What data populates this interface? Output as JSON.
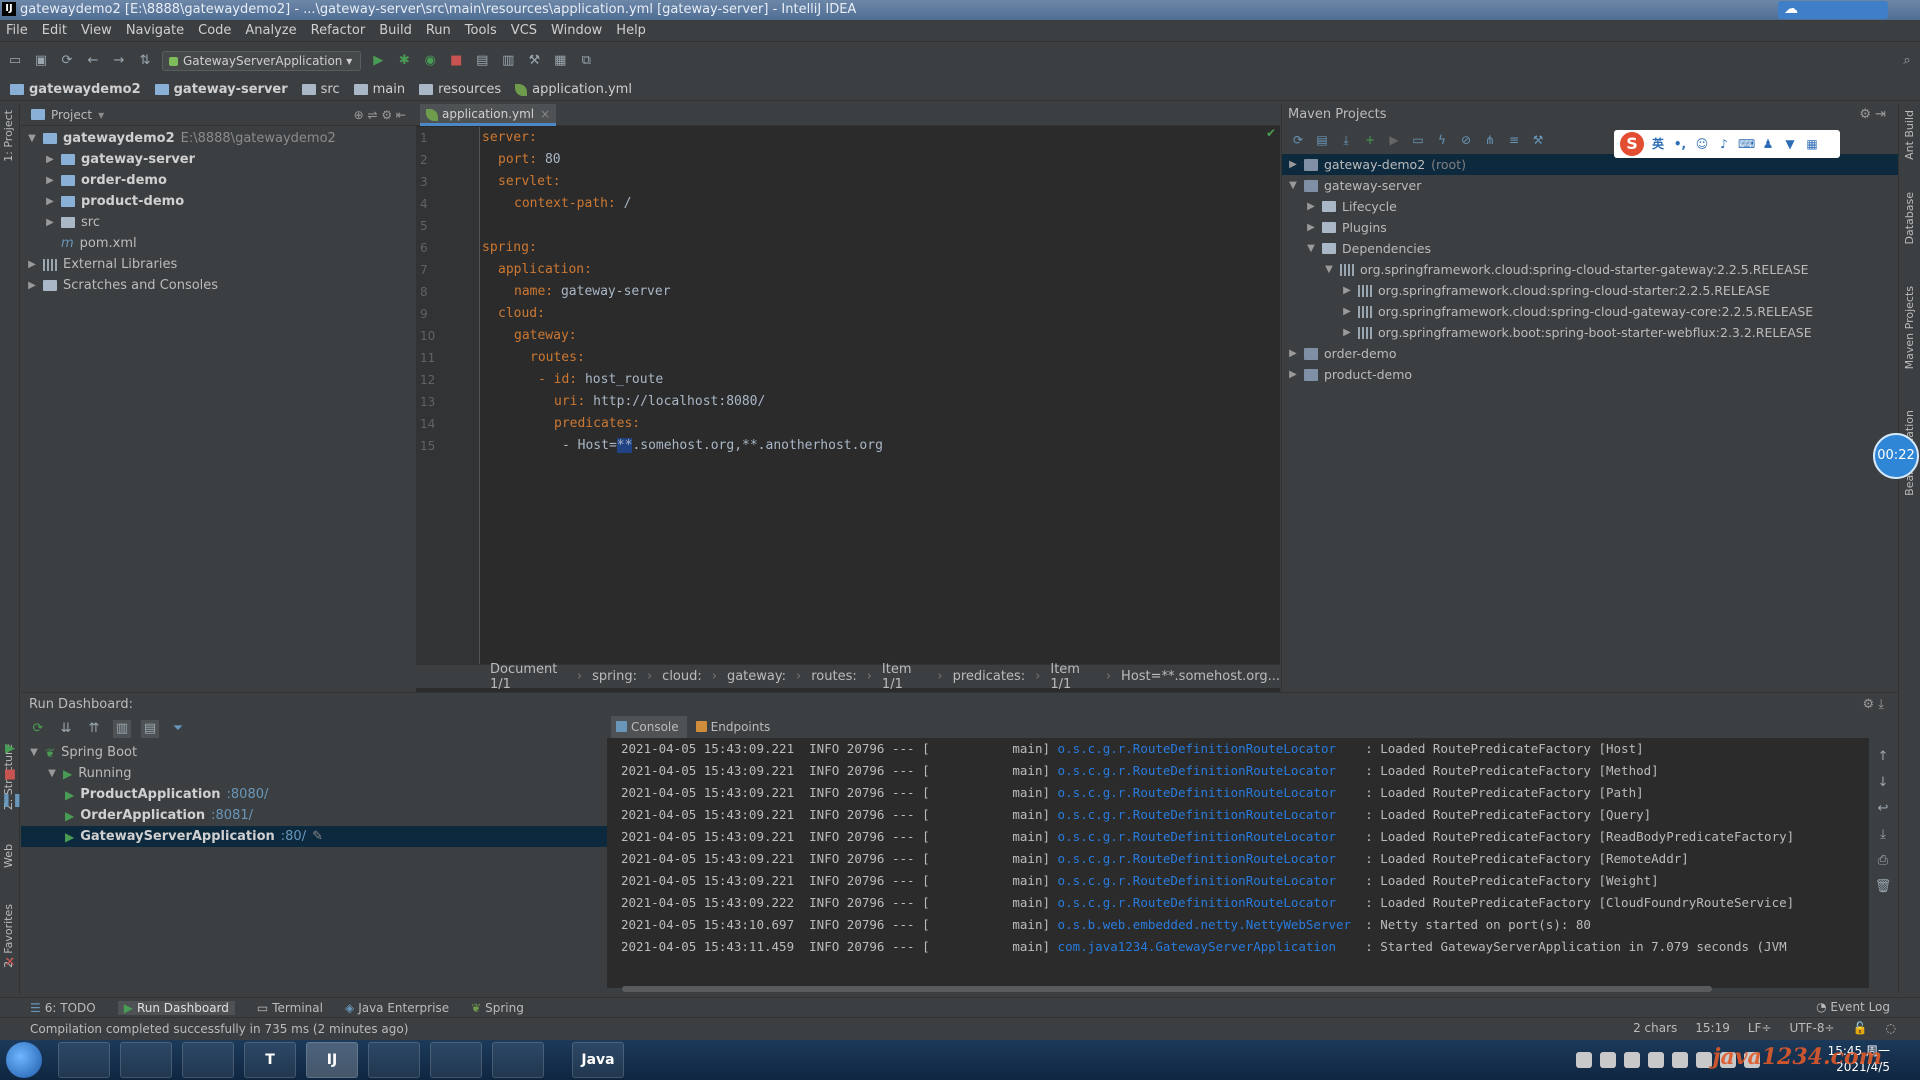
{
  "window": {
    "title": "gatewaydemo2 [E:\\8888\\gatewaydemo2] - ...\\gateway-server\\src\\main\\resources\\application.yml [gateway-server] - IntelliJ IDEA",
    "app_icon_label": "IJ"
  },
  "menu": [
    "File",
    "Edit",
    "View",
    "Navigate",
    "Code",
    "Analyze",
    "Refactor",
    "Build",
    "Run",
    "Tools",
    "VCS",
    "Window",
    "Help"
  ],
  "toolbar": {
    "run_config": "GatewayServerApplication"
  },
  "navbar": {
    "crumbs": [
      "gatewaydemo2",
      "gateway-server",
      "src",
      "main",
      "resources",
      "application.yml"
    ]
  },
  "left_strip": {
    "project_tab": "1: Project",
    "structure_tab": "Z: Structure",
    "web_tab": "Web",
    "favorites_tab": "2: Favorites"
  },
  "project": {
    "header": "Project",
    "tree": [
      {
        "label": "gatewaydemo2",
        "extra": "E:\\8888\\gatewaydemo2",
        "indent": 0,
        "expanded": true,
        "bold": true,
        "kind": "module"
      },
      {
        "label": "gateway-server",
        "indent": 1,
        "expanded": false,
        "bold": true,
        "kind": "module"
      },
      {
        "label": "order-demo",
        "indent": 1,
        "expanded": false,
        "bold": true,
        "kind": "module"
      },
      {
        "label": "product-demo",
        "indent": 1,
        "expanded": false,
        "bold": true,
        "kind": "module"
      },
      {
        "label": "src",
        "indent": 1,
        "expanded": false,
        "bold": false,
        "kind": "folder"
      },
      {
        "label": "pom.xml",
        "indent": 1,
        "expanded": null,
        "bold": false,
        "kind": "file"
      },
      {
        "label": "External Libraries",
        "indent": 0,
        "expanded": false,
        "bold": false,
        "kind": "lib"
      },
      {
        "label": "Scratches and Consoles",
        "indent": 0,
        "expanded": false,
        "bold": false,
        "kind": "scratch"
      }
    ]
  },
  "editor": {
    "tab": "application.yml",
    "lines": [
      {
        "n": "1",
        "key": "server:",
        "val": "",
        "indent": 0
      },
      {
        "n": "2",
        "key": "port:",
        "val": " 80",
        "indent": 1
      },
      {
        "n": "3",
        "key": "servlet:",
        "val": "",
        "indent": 1
      },
      {
        "n": "4",
        "key": "context-path:",
        "val": " /",
        "indent": 2
      },
      {
        "n": "5",
        "key": "",
        "val": "",
        "indent": 0
      },
      {
        "n": "6",
        "key": "spring:",
        "val": "",
        "indent": 0
      },
      {
        "n": "7",
        "key": "application:",
        "val": "",
        "indent": 1
      },
      {
        "n": "8",
        "key": "name:",
        "val": " gateway-server",
        "indent": 2
      },
      {
        "n": "9",
        "key": "cloud:",
        "val": "",
        "indent": 1
      },
      {
        "n": "10",
        "key": "gateway:",
        "val": "",
        "indent": 2
      },
      {
        "n": "11",
        "key": "routes:",
        "val": "",
        "indent": 3
      },
      {
        "n": "12",
        "key": "- id:",
        "val": " host_route",
        "indent": 3.5
      },
      {
        "n": "13",
        "key": "uri:",
        "val": " http://localhost:8080/",
        "indent": 4.5
      },
      {
        "n": "14",
        "key": "predicates:",
        "val": "",
        "indent": 4.5
      },
      {
        "n": "15",
        "key": "",
        "val": "- Host=",
        "sel": "**",
        "rest": ".somehost.org,**.anotherhost.org",
        "indent": 5
      }
    ],
    "breadcrumbs": [
      "Document 1/1",
      "spring:",
      "cloud:",
      "gateway:",
      "routes:",
      "Item 1/1",
      "predicates:",
      "Item 1/1",
      "Host=**.somehost.org..."
    ]
  },
  "maven": {
    "title": "Maven Projects",
    "rows": [
      {
        "label": "gateway-demo2",
        "suffix": " (root)",
        "indent": 0,
        "expanded": false,
        "icon": "module",
        "selected": true
      },
      {
        "label": "gateway-server",
        "suffix": "",
        "indent": 0,
        "expanded": true,
        "icon": "module",
        "selected": false
      },
      {
        "label": "Lifecycle",
        "suffix": "",
        "indent": 1,
        "expanded": false,
        "icon": "folder",
        "selected": false
      },
      {
        "label": "Plugins",
        "suffix": "",
        "indent": 1,
        "expanded": false,
        "icon": "folder",
        "selected": false
      },
      {
        "label": "Dependencies",
        "suffix": "",
        "indent": 1,
        "expanded": true,
        "icon": "folder",
        "selected": false
      },
      {
        "label": "org.springframework.cloud:spring-cloud-starter-gateway:2.2.5.RELEASE",
        "suffix": "",
        "indent": 2,
        "expanded": true,
        "icon": "lib",
        "selected": false
      },
      {
        "label": "org.springframework.cloud:spring-cloud-starter:2.2.5.RELEASE",
        "suffix": "",
        "indent": 3,
        "expanded": false,
        "icon": "lib",
        "selected": false
      },
      {
        "label": "org.springframework.cloud:spring-cloud-gateway-core:2.2.5.RELEASE",
        "suffix": "",
        "indent": 3,
        "expanded": false,
        "icon": "lib",
        "selected": false
      },
      {
        "label": "org.springframework.boot:spring-boot-starter-webflux:2.3.2.RELEASE",
        "suffix": "",
        "indent": 3,
        "expanded": false,
        "icon": "lib",
        "selected": false
      },
      {
        "label": "order-demo",
        "suffix": "",
        "indent": 0,
        "expanded": false,
        "icon": "module",
        "selected": false
      },
      {
        "label": "product-demo",
        "suffix": "",
        "indent": 0,
        "expanded": false,
        "icon": "module",
        "selected": false
      }
    ],
    "ime_logo": "S",
    "ime_label": "英"
  },
  "right_strip": {
    "ant": "Ant Build",
    "database": "Database",
    "maven": "Maven Projects",
    "bean": "Bean Validation"
  },
  "timer": "00:22",
  "run_dashboard": {
    "title": "Run Dashboard:",
    "tree": [
      {
        "label": "Spring Boot",
        "port": "",
        "indent": 0,
        "kind": "group"
      },
      {
        "label": "Running",
        "port": "",
        "indent": 1,
        "kind": "group"
      },
      {
        "label": "ProductApplication",
        "port": ":8080/",
        "indent": 2,
        "kind": "app",
        "selected": false
      },
      {
        "label": "OrderApplication",
        "port": ":8081/",
        "indent": 2,
        "kind": "app",
        "selected": false
      },
      {
        "label": "GatewayServerApplication",
        "port": ":80/",
        "indent": 2,
        "kind": "app",
        "selected": true
      }
    ]
  },
  "console": {
    "tabs": [
      "Console",
      "Endpoints"
    ],
    "lines": [
      {
        "ts": "2021-04-05 15:43:09.221",
        "lvl": "INFO",
        "pid": "20796",
        "thread": "main",
        "logger": "o.s.c.g.r.RouteDefinitionRouteLocator",
        "msg": ": Loaded RoutePredicateFactory [Host]"
      },
      {
        "ts": "2021-04-05 15:43:09.221",
        "lvl": "INFO",
        "pid": "20796",
        "thread": "main",
        "logger": "o.s.c.g.r.RouteDefinitionRouteLocator",
        "msg": ": Loaded RoutePredicateFactory [Method]"
      },
      {
        "ts": "2021-04-05 15:43:09.221",
        "lvl": "INFO",
        "pid": "20796",
        "thread": "main",
        "logger": "o.s.c.g.r.RouteDefinitionRouteLocator",
        "msg": ": Loaded RoutePredicateFactory [Path]"
      },
      {
        "ts": "2021-04-05 15:43:09.221",
        "lvl": "INFO",
        "pid": "20796",
        "thread": "main",
        "logger": "o.s.c.g.r.RouteDefinitionRouteLocator",
        "msg": ": Loaded RoutePredicateFactory [Query]"
      },
      {
        "ts": "2021-04-05 15:43:09.221",
        "lvl": "INFO",
        "pid": "20796",
        "thread": "main",
        "logger": "o.s.c.g.r.RouteDefinitionRouteLocator",
        "msg": ": Loaded RoutePredicateFactory [ReadBodyPredicateFactory]"
      },
      {
        "ts": "2021-04-05 15:43:09.221",
        "lvl": "INFO",
        "pid": "20796",
        "thread": "main",
        "logger": "o.s.c.g.r.RouteDefinitionRouteLocator",
        "msg": ": Loaded RoutePredicateFactory [RemoteAddr]"
      },
      {
        "ts": "2021-04-05 15:43:09.221",
        "lvl": "INFO",
        "pid": "20796",
        "thread": "main",
        "logger": "o.s.c.g.r.RouteDefinitionRouteLocator",
        "msg": ": Loaded RoutePredicateFactory [Weight]"
      },
      {
        "ts": "2021-04-05 15:43:09.222",
        "lvl": "INFO",
        "pid": "20796",
        "thread": "main",
        "logger": "o.s.c.g.r.RouteDefinitionRouteLocator",
        "msg": ": Loaded RoutePredicateFactory [CloudFoundryRouteService]"
      },
      {
        "ts": "2021-04-05 15:43:10.697",
        "lvl": "INFO",
        "pid": "20796",
        "thread": "main",
        "logger": "o.s.b.web.embedded.netty.NettyWebServer",
        "msg": ": Netty started on port(s): 80"
      },
      {
        "ts": "2021-04-05 15:43:11.459",
        "lvl": "INFO",
        "pid": "20796",
        "thread": "main",
        "logger": "com.java1234.GatewayServerApplication",
        "msg": ": Started GatewayServerApplication in 7.079 seconds (JVM"
      }
    ]
  },
  "bottom_tabs": [
    "6: TODO",
    "Run Dashboard",
    "Terminal",
    "Java Enterprise",
    "Spring"
  ],
  "event_log": "Event Log",
  "status": {
    "message": "Compilation completed successfully in 735 ms (2 minutes ago)",
    "chars": "2 chars",
    "position": "15:19",
    "line_sep": "LF÷",
    "encoding": "UTF-8÷"
  },
  "taskbar": {
    "apps": [
      "",
      "",
      "",
      "T",
      "IJ",
      "",
      "",
      "",
      "Java"
    ],
    "time": "15:45 周一",
    "date": "2021/4/5"
  },
  "watermark": "java1234.com"
}
